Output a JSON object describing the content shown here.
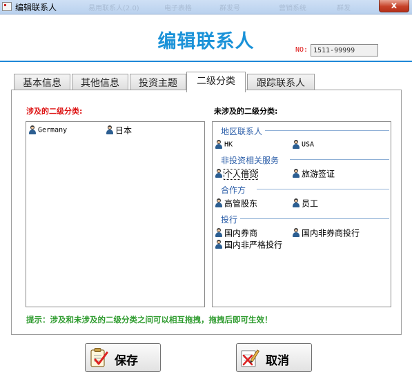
{
  "window": {
    "title": "编辑联系人",
    "close_label": "x",
    "ghost_titles": [
      "易用联系人(2.0)",
      "电子表格",
      "群发号",
      "营销系统",
      "群发"
    ]
  },
  "header": {
    "title": "编辑联系人",
    "no_label": "NO:",
    "no_value": "1511-99999"
  },
  "tabs": [
    {
      "label": "基本信息"
    },
    {
      "label": "其他信息"
    },
    {
      "label": "投资主题"
    },
    {
      "label": "二级分类"
    },
    {
      "label": "跟踪联系人"
    }
  ],
  "active_tab": "二级分类",
  "involved": {
    "label": "涉及的二级分类:",
    "items": [
      {
        "text": "Germany"
      },
      {
        "text": "日本"
      }
    ]
  },
  "not_involved": {
    "label": "未涉及的二级分类:",
    "groups": [
      {
        "name": "地区联系人",
        "items": [
          {
            "text": "HK"
          },
          {
            "text": "USA"
          }
        ]
      },
      {
        "name": "非投资相关服务",
        "items": [
          {
            "text": "个人借贷"
          },
          {
            "text": "旅游签证"
          }
        ]
      },
      {
        "name": "合作方",
        "items": [
          {
            "text": "高管股东"
          },
          {
            "text": "员工"
          }
        ]
      },
      {
        "name": "投行",
        "items": [
          {
            "text": "国内券商"
          },
          {
            "text": "国内非券商投行"
          },
          {
            "text": "国内非严格投行"
          }
        ]
      }
    ]
  },
  "hint": "提示：涉及和未涉及的二级分类之间可以相互拖拽，拖拽后即可生效！",
  "buttons": {
    "save": "保存",
    "cancel": "取消"
  },
  "colors": {
    "accent": "#1a92d8",
    "required_red": "#dd1111",
    "hint_green": "#2e9b2e",
    "group_blue": "#2a5da8"
  },
  "icons": {
    "app": "app-window-icon",
    "user": "user-icon",
    "save": "clipboard-check-icon",
    "cancel": "pen-cancel-icon"
  }
}
